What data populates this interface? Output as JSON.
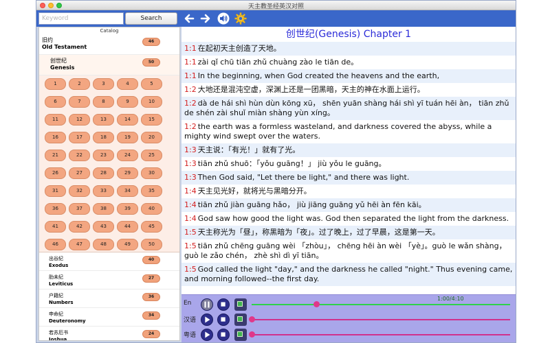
{
  "window": {
    "title": "天主教圣经英汉对照"
  },
  "toolbar": {
    "search_placeholder": "Keyword",
    "search_label": "Search",
    "icons": [
      "back-arrow-icon",
      "forward-arrow-icon",
      "speaker-icon",
      "gear-icon"
    ]
  },
  "sidebar": {
    "catalog_title": "Catalog",
    "testament": {
      "zh": "旧约",
      "en": "Old Testament",
      "count": "46"
    },
    "current_book": {
      "zh": "创世纪",
      "en": "Genesis",
      "count": "50"
    },
    "chapters": [
      "1",
      "2",
      "3",
      "4",
      "5",
      "6",
      "7",
      "8",
      "9",
      "10",
      "11",
      "12",
      "13",
      "14",
      "15",
      "16",
      "17",
      "18",
      "19",
      "20",
      "21",
      "22",
      "23",
      "24",
      "25",
      "26",
      "27",
      "28",
      "29",
      "30",
      "31",
      "32",
      "33",
      "34",
      "35",
      "36",
      "37",
      "38",
      "39",
      "40",
      "41",
      "42",
      "43",
      "44",
      "45",
      "46",
      "47",
      "48",
      "49",
      "50"
    ],
    "books": [
      {
        "zh": "出谷纪",
        "en": "Exodus",
        "count": "40"
      },
      {
        "zh": "肋未纪",
        "en": "Leviticus",
        "count": "27"
      },
      {
        "zh": "户籍纪",
        "en": "Numbers",
        "count": "36"
      },
      {
        "zh": "申命纪",
        "en": "Deuteronomy",
        "count": "34"
      },
      {
        "zh": "若苏厄书",
        "en": "Joshua",
        "count": "24"
      }
    ]
  },
  "content": {
    "chapter_title": "创世纪(Genesis) Chapter 1",
    "verses": [
      {
        "ref": "1:1",
        "text": "在起初天主创造了天地。"
      },
      {
        "ref": "1:1",
        "text": "zài qǐ chū tiān zhǔ chuàng zào le tiān de。"
      },
      {
        "ref": "1:1",
        "text": "In the beginning, when God created the heavens and the earth,"
      },
      {
        "ref": "1:2",
        "text": "大地还是混沌空虚，深渊上还是一团黑暗，天主的神在水面上运行。"
      },
      {
        "ref": "1:2",
        "text": "dà de hái shì hùn dùn kōng xū， shēn yuān shàng hái shì yī tuán hēi àn， tiān zhǔ de shén zài shuǐ miàn shàng yùn xíng。"
      },
      {
        "ref": "1:2",
        "text": "the earth was a formless wasteland, and darkness covered the abyss, while a mighty wind swept over the waters."
      },
      {
        "ref": "1:3",
        "text": "天主说：「有光！」就有了光。"
      },
      {
        "ref": "1:3",
        "text": "tiān zhǔ shuō：「yǒu guāng！」 jiù yǒu le guāng。"
      },
      {
        "ref": "1:3",
        "text": "Then God said, \"Let there be light,\" and there was light."
      },
      {
        "ref": "1:4",
        "text": "天主见光好，就将光与黑暗分开。"
      },
      {
        "ref": "1:4",
        "text": "tiān zhǔ jiàn guāng hǎo， jiù jiāng guāng yǔ hēi àn fēn kāi。"
      },
      {
        "ref": "1:4",
        "text": "God saw how good the light was. God then separated the light from the darkness."
      },
      {
        "ref": "1:5",
        "text": "天主称光为「昼」，称黑暗为「夜」。过了晚上，过了早晨，这是第一天。"
      },
      {
        "ref": "1:5",
        "text": "tiān zhǔ chēng guāng wèi 「zhòu」， chēng hēi àn wèi 「yè」。guò le wǎn shàng， guò le zǎo chén， zhè shì dì yī tiān。"
      },
      {
        "ref": "1:5",
        "text": "God called the light \"day,\" and the darkness he called \"night.\" Thus evening came, and morning followed--the first day."
      }
    ]
  },
  "player": {
    "rows": [
      {
        "label": "En",
        "progress": 0.25,
        "track_color": "#2fd24a",
        "knob_color": "#e0388a"
      },
      {
        "label": "汉语",
        "progress": 0.0,
        "track_color": "#d0308c",
        "knob_color": "#e0388a"
      },
      {
        "label": "粤语",
        "progress": 0.0,
        "track_color": "#d0308c",
        "knob_color": "#e0388a"
      }
    ],
    "time": "1:00/4:10"
  }
}
